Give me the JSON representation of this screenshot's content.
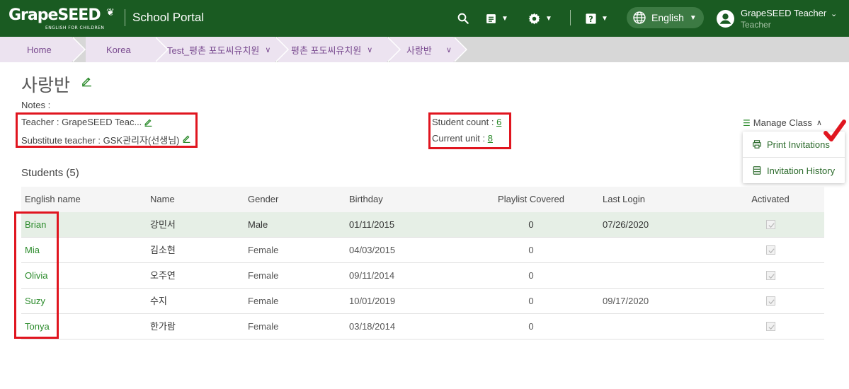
{
  "header": {
    "logo_text": "GrapeSEED",
    "logo_tagline": "ENGLISH FOR CHILDREN",
    "portal_title": "School Portal",
    "language": "English",
    "user_name": "GrapeSEED Teacher",
    "user_role": "Teacher"
  },
  "breadcrumb": [
    {
      "label": "Home"
    },
    {
      "label": "Korea"
    },
    {
      "label": "Test_평촌 포도씨유치원"
    },
    {
      "label": "평촌 포도씨유치원"
    },
    {
      "label": "사랑반"
    }
  ],
  "class": {
    "title": "사랑반",
    "notes_label": "Notes :",
    "teacher_label": "Teacher : GrapeSEED Teac...",
    "substitute_label": "Substitute teacher : GSK관리자(선생님)",
    "student_count_label": "Student count : ",
    "student_count": "6",
    "current_unit_label": "Current unit : ",
    "current_unit": "8"
  },
  "manage_class": {
    "label": "Manage Class",
    "items": [
      {
        "label": "Print Invitations"
      },
      {
        "label": "Invitation History"
      }
    ]
  },
  "students": {
    "title": "Students (5)",
    "columns": [
      "English name",
      "Name",
      "Gender",
      "Birthday",
      "Playlist Covered",
      "Last Login",
      "Activated"
    ],
    "rows": [
      {
        "english": "Brian",
        "name": "강민서",
        "gender": "Male",
        "birthday": "01/11/2015",
        "playlist": "0",
        "last_login": "07/26/2020",
        "activated": true
      },
      {
        "english": "Mia",
        "name": "김소현",
        "gender": "Female",
        "birthday": "04/03/2015",
        "playlist": "0",
        "last_login": "",
        "activated": true
      },
      {
        "english": "Olivia",
        "name": "오주연",
        "gender": "Female",
        "birthday": "09/11/2014",
        "playlist": "0",
        "last_login": "",
        "activated": true
      },
      {
        "english": "Suzy",
        "name": "수지",
        "gender": "Female",
        "birthday": "10/01/2019",
        "playlist": "0",
        "last_login": "09/17/2020",
        "activated": true
      },
      {
        "english": "Tonya",
        "name": "한가람",
        "gender": "Female",
        "birthday": "03/18/2014",
        "playlist": "0",
        "last_login": "",
        "activated": true
      }
    ]
  },
  "colors": {
    "header_bg": "#1a5b22",
    "accent_green": "#2a8a2a",
    "breadcrumb_bg": "#ece3f0",
    "breadcrumb_text": "#7a4b90",
    "highlight_red": "#e0151f"
  }
}
